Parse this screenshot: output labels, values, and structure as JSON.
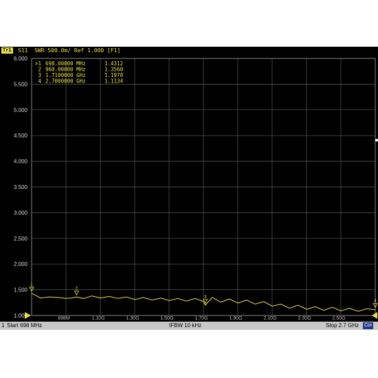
{
  "header": {
    "trace_tag": "Tr1",
    "trace_info": "S11  SWR 500.0m/ Ref 1.000 [F1]"
  },
  "markers": [
    {
      "active": ">1",
      "freq": "698.00000 MHz",
      "value": "1.4312"
    },
    {
      "active": "2",
      "freq": "960.00000 MHz",
      "value": "1.3560"
    },
    {
      "active": "3",
      "freq": "1.7100000 GHz",
      "value": "1.1970"
    },
    {
      "active": "4",
      "freq": "2.7000000 GHz",
      "value": "1.1134"
    }
  ],
  "statusbar": {
    "channel": "1",
    "start": "Start 698 MHz",
    "ifbw": "IFBW 10 kHz",
    "stop": "Stop 2.7 GHz",
    "cor": "Cor"
  },
  "colors": {
    "trace": "#e8e04a",
    "grid": "#5a5a5a",
    "background": "#000000"
  },
  "chart_data": {
    "type": "line",
    "title": "",
    "xlabel": "",
    "ylabel": "",
    "y_ticks": [
      "6.000",
      "5.500",
      "5.000",
      "4.500",
      "4.000",
      "3.500",
      "3.000",
      "2.500",
      "2.000",
      "1.500",
      "1.000"
    ],
    "x_ticks": [
      "898M",
      "1.10G",
      "1.30G",
      "1.50G",
      "1.70G",
      "1.90G",
      "2.10G",
      "2.30G",
      "2.50G"
    ],
    "ylim": [
      1.0,
      6.0
    ],
    "xlim": [
      0.698,
      2.7
    ],
    "grid": true,
    "series": [
      {
        "x": [
          0.698,
          0.75,
          0.8,
          0.85,
          0.898,
          0.93,
          0.96,
          1.0,
          1.05,
          1.1,
          1.15,
          1.2,
          1.25,
          1.3,
          1.35,
          1.4,
          1.45,
          1.5,
          1.55,
          1.6,
          1.65,
          1.7,
          1.71,
          1.75,
          1.8,
          1.85,
          1.9,
          1.95,
          2.0,
          2.05,
          2.1,
          2.15,
          2.2,
          2.25,
          2.3,
          2.35,
          2.4,
          2.45,
          2.5,
          2.55,
          2.6,
          2.65,
          2.7
        ],
        "y": [
          1.43,
          1.34,
          1.36,
          1.35,
          1.33,
          1.34,
          1.36,
          1.33,
          1.38,
          1.34,
          1.37,
          1.33,
          1.36,
          1.31,
          1.35,
          1.3,
          1.34,
          1.29,
          1.33,
          1.28,
          1.33,
          1.27,
          1.2,
          1.35,
          1.26,
          1.32,
          1.24,
          1.3,
          1.22,
          1.27,
          1.18,
          1.22,
          1.14,
          1.2,
          1.12,
          1.17,
          1.1,
          1.16,
          1.09,
          1.14,
          1.08,
          1.13,
          1.11
        ]
      }
    ],
    "marker_points": [
      {
        "label": "1",
        "x": 0.698,
        "y": 1.4312
      },
      {
        "label": "2",
        "x": 0.96,
        "y": 1.356
      },
      {
        "label": "3",
        "x": 1.71,
        "y": 1.197
      },
      {
        "label": "4",
        "x": 2.7,
        "y": 1.1134
      }
    ]
  }
}
